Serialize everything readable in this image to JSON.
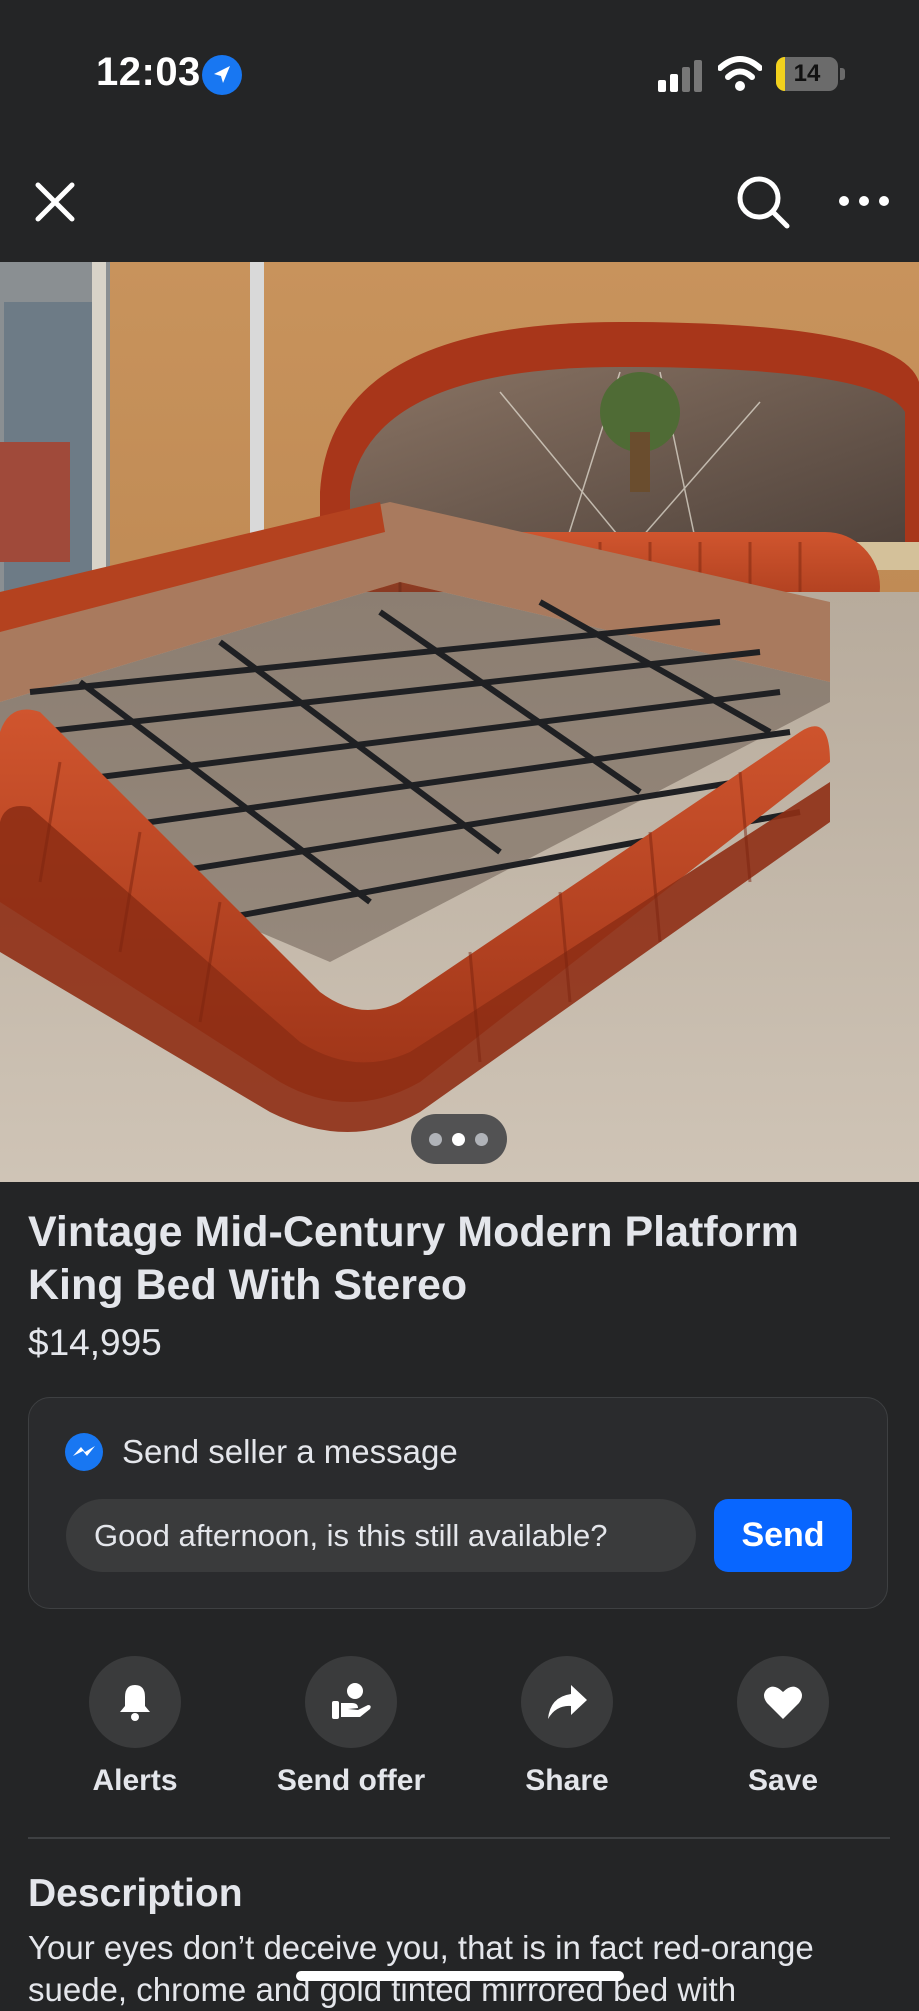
{
  "status_bar": {
    "time": "12:03",
    "battery_level": "14",
    "battery_fraction": 0.14,
    "icons": [
      "location-arrow-icon",
      "signal-icon",
      "wifi-icon",
      "battery-icon"
    ]
  },
  "nav": {
    "icons": [
      "close-icon",
      "search-icon",
      "more-icon"
    ]
  },
  "photo": {
    "subject": "red-orange velvet platform king bed with mirrored headboard",
    "page_count": 3,
    "active_page": 2
  },
  "listing": {
    "title": "Vintage Mid-Century Modern Platform King Bed With Stereo",
    "price": "$14,995"
  },
  "message": {
    "label": "Send seller a message",
    "input_value": "Good afternoon, is this still available?",
    "send_label": "Send",
    "icon": "messenger-icon"
  },
  "actions": [
    {
      "label": "Alerts",
      "icon": "bell-icon"
    },
    {
      "label": "Send offer",
      "icon": "send-offer-icon"
    },
    {
      "label": "Share",
      "icon": "share-icon"
    },
    {
      "label": "Save",
      "icon": "heart-icon"
    }
  ],
  "description": {
    "heading": "Description",
    "text": "Your eyes don’t deceive you, that is in fact red-orange suede, chrome and gold tinted mirrored bed with"
  },
  "colors": {
    "background": "#242526",
    "accent": "#0866ff",
    "messenger": "#1877f2",
    "battery": "#f2d11d"
  }
}
